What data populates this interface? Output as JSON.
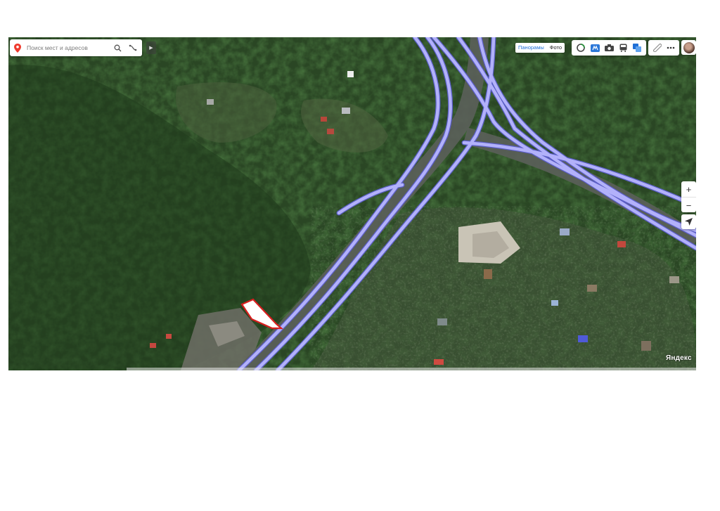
{
  "search": {
    "placeholder": "Поиск мест и адресов"
  },
  "layers": {
    "panoramas": "Панорамы",
    "photo": "Фото"
  },
  "toolbar": {
    "group1": [
      "traffic-icon",
      "metro-icon",
      "camera-icon",
      "bus-icon",
      "layers-icon"
    ],
    "group2": [
      "ruler-icon",
      "more-icon"
    ]
  },
  "zoom": {
    "in": "+",
    "out": "−"
  },
  "logo": "Яндекс",
  "colors": {
    "route": "#aaa9f5",
    "route_edge": "#6e6ee0",
    "parcel_fill": "#ffffff",
    "parcel_border": "#d71f1f",
    "forest": "#24401f"
  }
}
